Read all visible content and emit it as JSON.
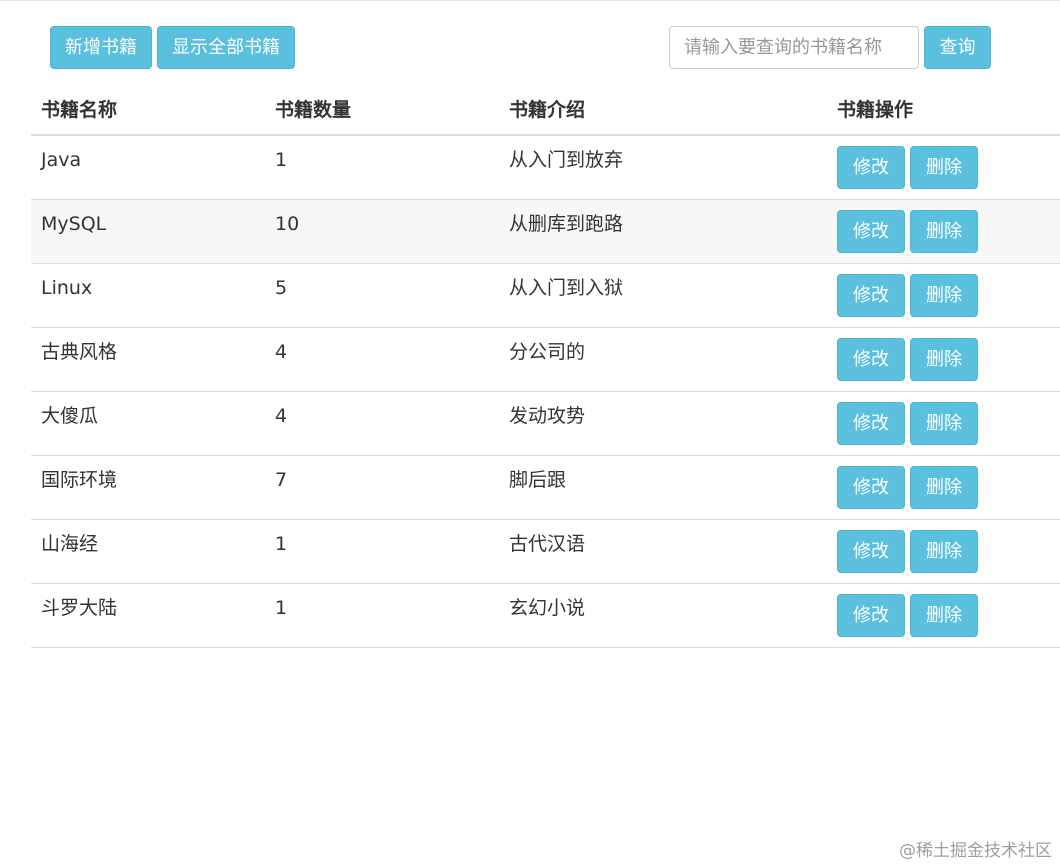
{
  "toolbar": {
    "add_label": "新增书籍",
    "show_all_label": "显示全部书籍",
    "search_placeholder": "请输入要查询的书籍名称",
    "search_value": "",
    "query_label": "查询"
  },
  "table": {
    "headers": [
      "书籍名称",
      "书籍数量",
      "书籍介绍",
      "书籍操作"
    ],
    "edit_label": "修改",
    "delete_label": "删除",
    "rows": [
      {
        "name": "Java",
        "count": "1",
        "desc": "从入门到放弃"
      },
      {
        "name": "MySQL",
        "count": "10",
        "desc": "从删库到跑路"
      },
      {
        "name": "Linux",
        "count": "5",
        "desc": "从入门到入狱"
      },
      {
        "name": "古典风格",
        "count": "4",
        "desc": "分公司的"
      },
      {
        "name": "大傻瓜",
        "count": "4",
        "desc": "发动攻势"
      },
      {
        "name": "国际环境",
        "count": "7",
        "desc": "脚后跟"
      },
      {
        "name": "山海经",
        "count": "1",
        "desc": "古代汉语"
      },
      {
        "name": "斗罗大陆",
        "count": "1",
        "desc": "玄幻小说"
      }
    ]
  },
  "watermark": "@稀土掘金技术社区",
  "colors": {
    "button_info": "#5bc0de",
    "button_info_border": "#46b8da",
    "stripe": "#f7f7f7",
    "divider": "#dddddd"
  }
}
